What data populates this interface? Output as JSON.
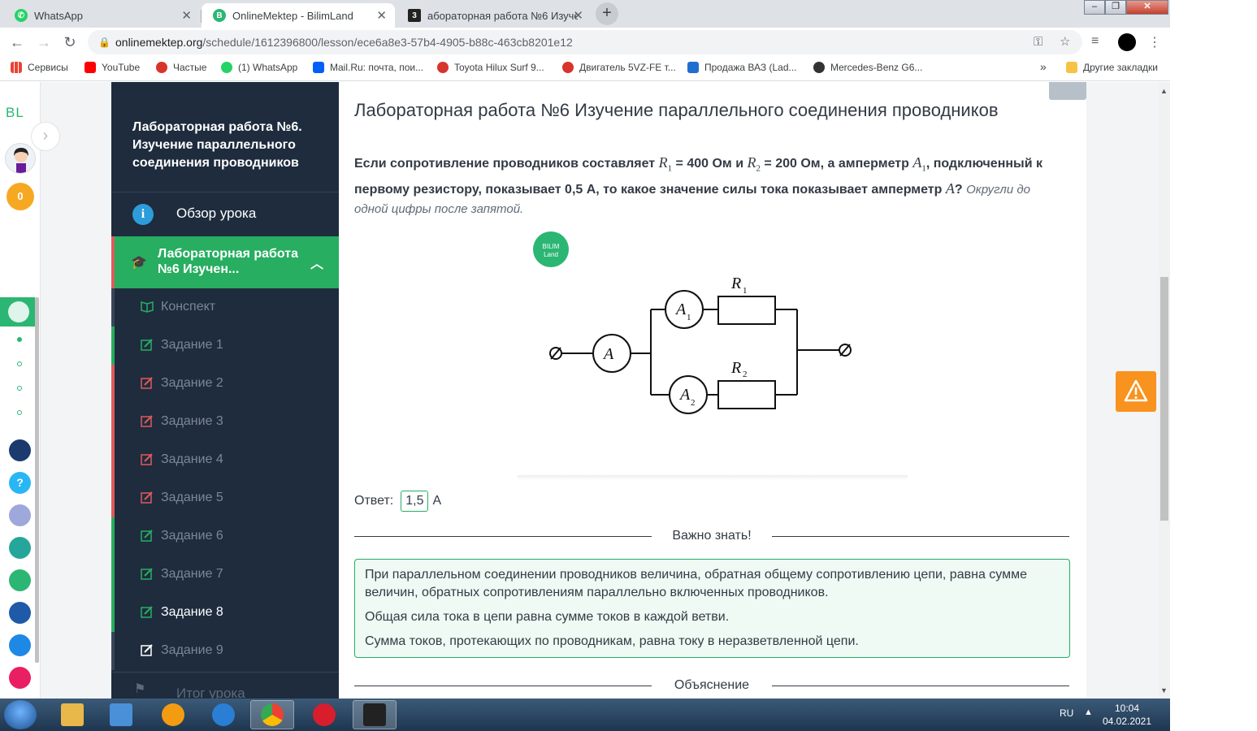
{
  "browser": {
    "tabs": [
      {
        "title": "WhatsApp",
        "active": false
      },
      {
        "title": "OnlineMektep - BilimLand",
        "active": true
      },
      {
        "title": "аборaторная работа №6 Изуче",
        "active": false
      }
    ],
    "url_host": "onlinemektep.org",
    "url_path": "/schedule/1612396800/lesson/ece6a8e3-57b4-4905-b88c-463cb8201e12"
  },
  "bookmarks": {
    "items": [
      "Сервисы",
      "YouTube",
      "Частые",
      "(1) WhatsApp",
      "Mail.Ru: почта, пои...",
      "Toyota Hilux Surf 9...",
      "Двигатель 5VZ-FE т...",
      "Продажа ВАЗ (Lad...",
      "Mercedes-Benz G6..."
    ],
    "overflow": "»",
    "other": "Другие закладки"
  },
  "rail": {
    "logo": "BL",
    "coins": "0"
  },
  "sidebar": {
    "lesson_title": "Лабораторная работа №6. Изучение параллельного соединения проводников",
    "overview": "Обзор урока",
    "current_section": "Лабораторная работа №6 Изучен...",
    "items": [
      {
        "label": "Конспект",
        "status": "plain"
      },
      {
        "label": "Задание 1",
        "status": "done"
      },
      {
        "label": "Задание 2",
        "status": "fail"
      },
      {
        "label": "Задание 3",
        "status": "fail"
      },
      {
        "label": "Задание 4",
        "status": "fail"
      },
      {
        "label": "Задание 5",
        "status": "fail"
      },
      {
        "label": "Задание 6",
        "status": "done"
      },
      {
        "label": "Задание 7",
        "status": "done"
      },
      {
        "label": "Задание 8",
        "status": "current"
      },
      {
        "label": "Задание 9",
        "status": "plain"
      }
    ],
    "summary": "Итог урока"
  },
  "main": {
    "title": "Лабораторная работа №6 Изучение параллельного соединения проводников",
    "question": {
      "p1": "Если сопротивление проводников составляет ",
      "r1": "R",
      "r1_sub": "1",
      "p2": " = 400 Ом и ",
      "r2": "R",
      "r2_sub": "2",
      "p3": " = 200 Ом, а амперметр ",
      "a1": "A",
      "a1_sub": "1",
      "p4": ", подключенный к первому резистору, показывает 0,5 А, то какое значение силы тока показывает амперметр ",
      "a": "A",
      "p5": "? ",
      "hint": "Округли до одной цифры после запятой."
    },
    "figure": {
      "badge_line1": "BILIM",
      "badge_line2": "Land",
      "ammeter_main": "A",
      "ammeter_1": "A",
      "ammeter_1_sub": "1",
      "ammeter_2": "A",
      "ammeter_2_sub": "2",
      "resistor_1": "R",
      "resistor_1_sub": "1",
      "resistor_2": "R",
      "resistor_2_sub": "2"
    },
    "answer_label": "Ответ:",
    "answer_value": "1,5",
    "answer_unit": "А",
    "important_label": "Важно знать!",
    "info": [
      "При параллельном соединении проводников величина, обратная общему сопротивлению цепи, равна сумме величин, обратных сопротивлениям параллельно включенных проводников.",
      "Общая сила тока в цепи равна сумме токов в каждой ветви.",
      "Сумма токов, протекающих по проводникам, равна току в неразветвленной цепи."
    ],
    "explanation_label": "Объяснение"
  },
  "taskbar": {
    "lang": "RU",
    "time": "10:04",
    "date": "04.02.2021"
  },
  "colors": {
    "accent_green": "#27ae60",
    "sidebar_bg": "#1e2c3e",
    "fail_red": "#e05a5a",
    "warning_orange": "#f7931e"
  }
}
